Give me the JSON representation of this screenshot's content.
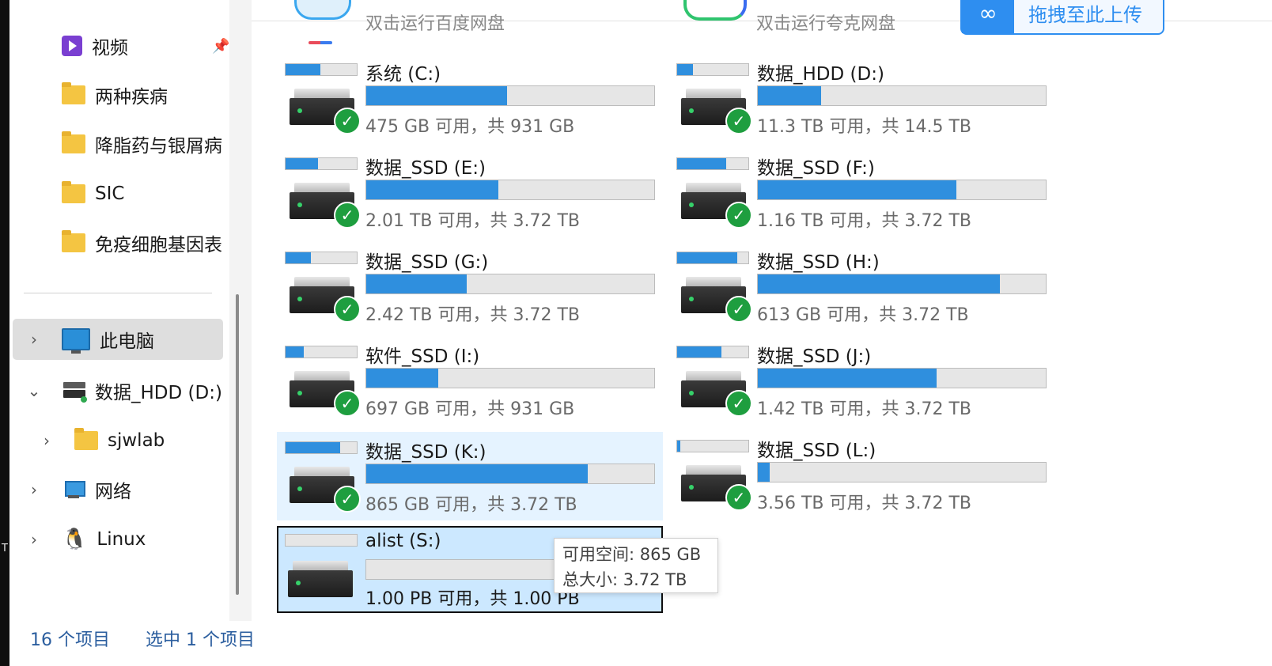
{
  "sidebar": {
    "quick_access": [
      {
        "label": "视频",
        "icon": "video-icon",
        "pinned": true
      },
      {
        "label": "两种疾病",
        "icon": "folder-icon"
      },
      {
        "label": "降脂药与银屑病",
        "icon": "folder-icon"
      },
      {
        "label": "SIC",
        "icon": "folder-icon"
      },
      {
        "label": "免疫细胞基因表",
        "icon": "folder-icon"
      }
    ],
    "tree": [
      {
        "label": "此电脑",
        "icon": "computer-icon",
        "selected": true
      },
      {
        "label": "数据_HDD (D:)",
        "icon": "drive-icon",
        "expanded": true
      },
      {
        "label": "sjwlab",
        "icon": "folder-icon"
      },
      {
        "label": "网络",
        "icon": "network-icon"
      },
      {
        "label": "Linux",
        "icon": "linux-icon"
      }
    ]
  },
  "top": {
    "app1_text": "双击运行百度网盘",
    "app2_text": "双击运行夸克网盘",
    "upload_label": "拖拽至此上传"
  },
  "drives": [
    {
      "name": "系统 (C:)",
      "free": "475 GB 可用，共 931 GB",
      "used_fraction": 0.49
    },
    {
      "name": "数据_HDD (D:)",
      "free": "11.3 TB 可用，共 14.5 TB",
      "used_fraction": 0.22
    },
    {
      "name": "数据_SSD (E:)",
      "free": "2.01 TB 可用，共 3.72 TB",
      "used_fraction": 0.46
    },
    {
      "name": "数据_SSD (F:)",
      "free": "1.16 TB 可用，共 3.72 TB",
      "used_fraction": 0.69
    },
    {
      "name": "数据_SSD (G:)",
      "free": "2.42 TB 可用，共 3.72 TB",
      "used_fraction": 0.35
    },
    {
      "name": "数据_SSD (H:)",
      "free": "613 GB 可用，共 3.72 TB",
      "used_fraction": 0.84
    },
    {
      "name": "软件_SSD (I:)",
      "free": "697 GB 可用，共 931 GB",
      "used_fraction": 0.25
    },
    {
      "name": "数据_SSD (J:)",
      "free": "1.42 TB 可用，共 3.72 TB",
      "used_fraction": 0.62
    },
    {
      "name": "数据_SSD (K:)",
      "free": "865 GB 可用，共 3.72 TB",
      "used_fraction": 0.77
    },
    {
      "name": "数据_SSD (L:)",
      "free": "3.56 TB 可用，共 3.72 TB",
      "used_fraction": 0.04
    },
    {
      "name": "alist (S:)",
      "free": "1.00 PB 可用，共 1.00 PB",
      "used_fraction": 0.0
    }
  ],
  "tooltip": {
    "free_space": "可用空间: 865 GB",
    "total_size": "总大小: 3.72 TB"
  },
  "status": {
    "item_count": "16 个项目",
    "selected_count": "选中 1 个项目"
  },
  "colors": {
    "accent": "#2f8fde",
    "highlight": "#e5f3ff",
    "selected": "#cce8ff"
  }
}
